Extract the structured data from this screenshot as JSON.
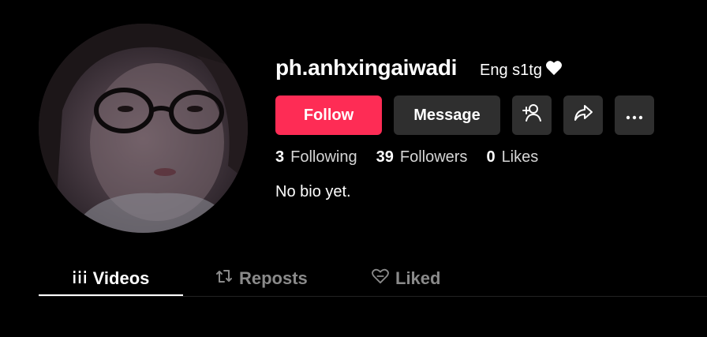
{
  "profile": {
    "username": "ph.anhxingaiwadi",
    "nickname": "Eng s1tg",
    "nickname_icon": "white-heart-icon",
    "bio": "No bio yet."
  },
  "buttons": {
    "follow_label": "Follow",
    "message_label": "Message",
    "add_friend_icon": "add-person-icon",
    "share_icon": "share-arrow-icon",
    "more_icon": "more-dots-icon"
  },
  "stats": [
    {
      "value": "3",
      "label": "Following"
    },
    {
      "value": "39",
      "label": "Followers"
    },
    {
      "value": "0",
      "label": "Likes"
    }
  ],
  "tabs": [
    {
      "label": "Videos",
      "icon": "videos-grid-icon",
      "active": true
    },
    {
      "label": "Reposts",
      "icon": "repost-icon",
      "active": false
    },
    {
      "label": "Liked",
      "icon": "liked-heart-icon",
      "active": false
    }
  ],
  "colors": {
    "background": "#000000",
    "follow_button": "#fe2c55",
    "secondary_button": "#2f2f2f",
    "inactive_tab": "#8a8a8a"
  }
}
